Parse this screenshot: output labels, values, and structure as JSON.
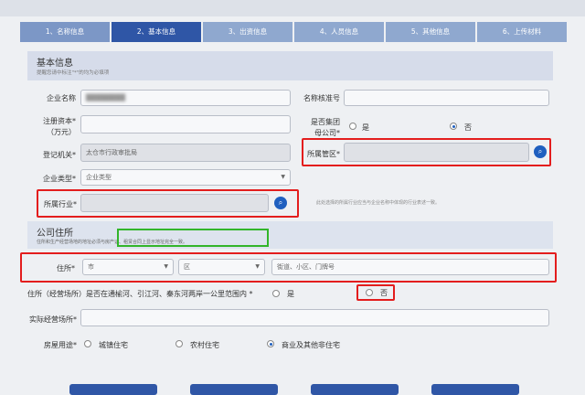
{
  "steps": [
    "1、名称信息",
    "2、基本信息",
    "3、出资信息",
    "4、人员信息",
    "5、其他信息",
    "6、上传材料"
  ],
  "basic": {
    "title": "基本信息",
    "hint": "提醒您请中标注\"*\"的均为必填项"
  },
  "fields": {
    "company_name_label": "企业名称",
    "name_approval_label": "名称核准号",
    "reg_capital_label": "注册资本*",
    "reg_capital_unit": "（万元）",
    "group_label_line1": "是否集团",
    "group_label_line2": "母公司*",
    "group_yes": "是",
    "group_no": "否",
    "reg_authority_label": "登记机关*",
    "reg_authority_value": "太仓市行政审批局",
    "district_label": "所属管区*",
    "company_type_label": "企业类型*",
    "company_type_placeholder": "企业类型",
    "industry_label": "所属行业*",
    "industry_hint": "此处选择的所属行业应当与企业名称中体现的行业表述一致。"
  },
  "address": {
    "title": "公司住所",
    "note": "住所和生产经营场地的地址必须与房产证、租赁合同上显示地址完全一致。",
    "label": "住所*",
    "city": "市",
    "district": "区",
    "street_placeholder": "街道、小区、门牌号",
    "river_question": "住所（经营场所）是否在通榆河、引江河、秦东河两岸一公里范围内 *",
    "river_yes": "是",
    "river_no": "否",
    "business_place_label": "实际经营场所*",
    "usage_label": "房屋用途*",
    "usage_options": [
      "城镇住宅",
      "农村住宅",
      "商业及其他非住宅"
    ]
  },
  "colors": {
    "step_active": "#2f56a6",
    "step_inactive": "#8fa8cf",
    "highlight_red": "#e31d1d",
    "highlight_green": "#32b52a"
  }
}
